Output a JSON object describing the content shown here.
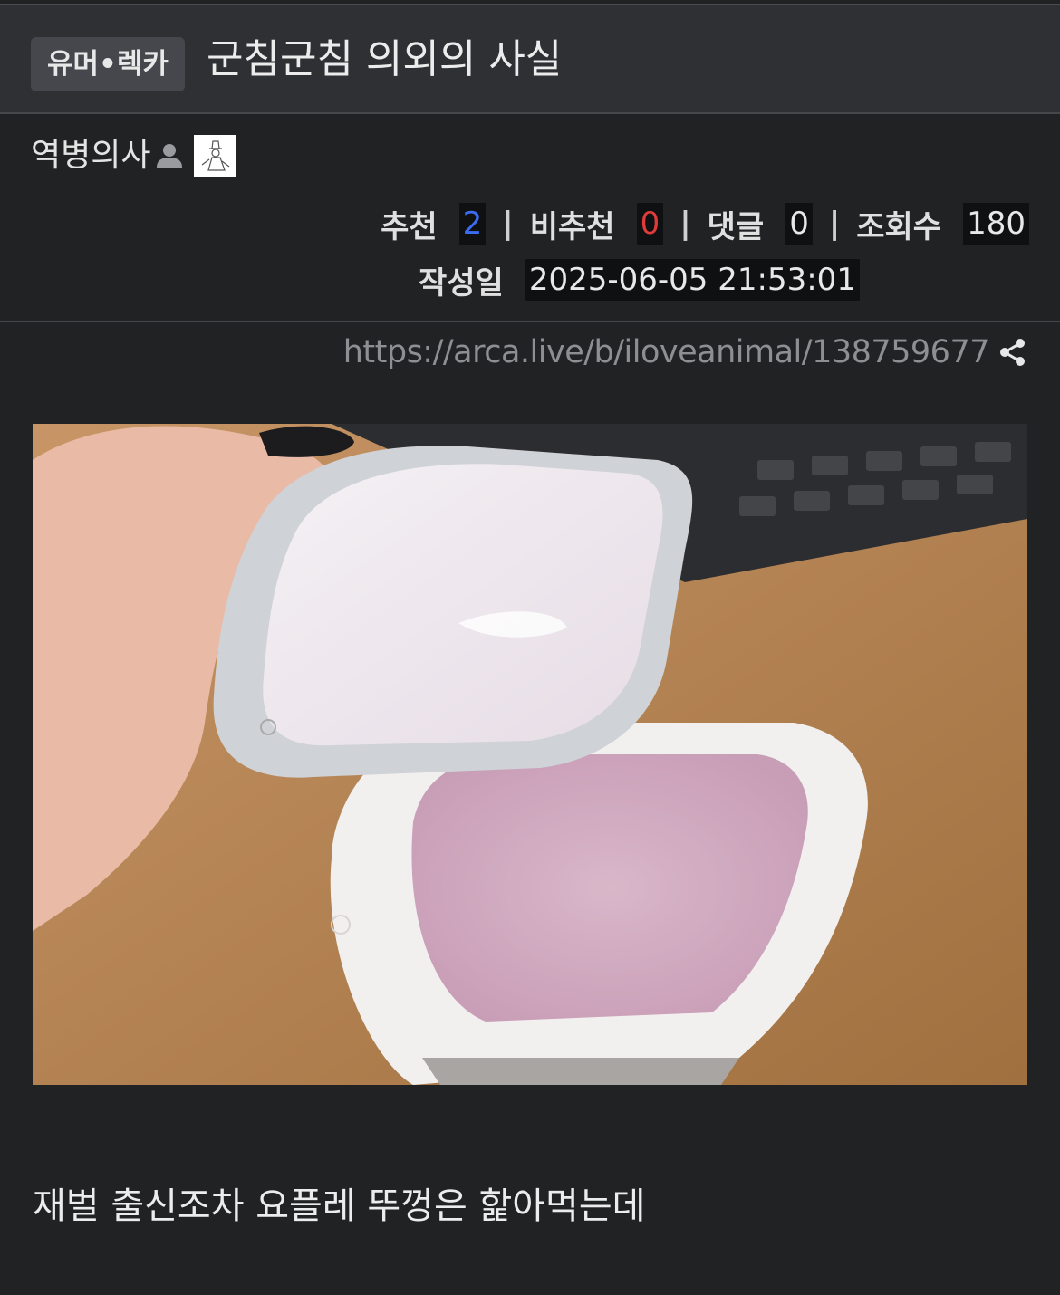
{
  "header": {
    "category": "유머•렉카",
    "title": "군침군침 의외의 사실"
  },
  "author": {
    "name": "역병의사",
    "icon": "user-icon"
  },
  "stats": {
    "recommend_label": "추천",
    "recommend_value": "2",
    "downvote_label": "비추천",
    "downvote_value": "0",
    "comments_label": "댓글",
    "comments_value": "0",
    "views_label": "조회수",
    "views_value": "180",
    "separator": "|",
    "date_label": "작성일",
    "date_value": "2025-06-05 21:53:01"
  },
  "link": {
    "url": "https://arca.live/b/iloveanimal/138759677",
    "icon": "share-icon"
  },
  "content": {
    "image_icon": "yogurt-photo",
    "text": "재벌 출신조차 요플레 뚜껑은 핥아먹는데"
  },
  "colors": {
    "background": "#212224",
    "title_bar": "#2f3033",
    "recommend": "#3b6cf3",
    "downvote": "#e03b3b",
    "url": "#8d8f93"
  }
}
